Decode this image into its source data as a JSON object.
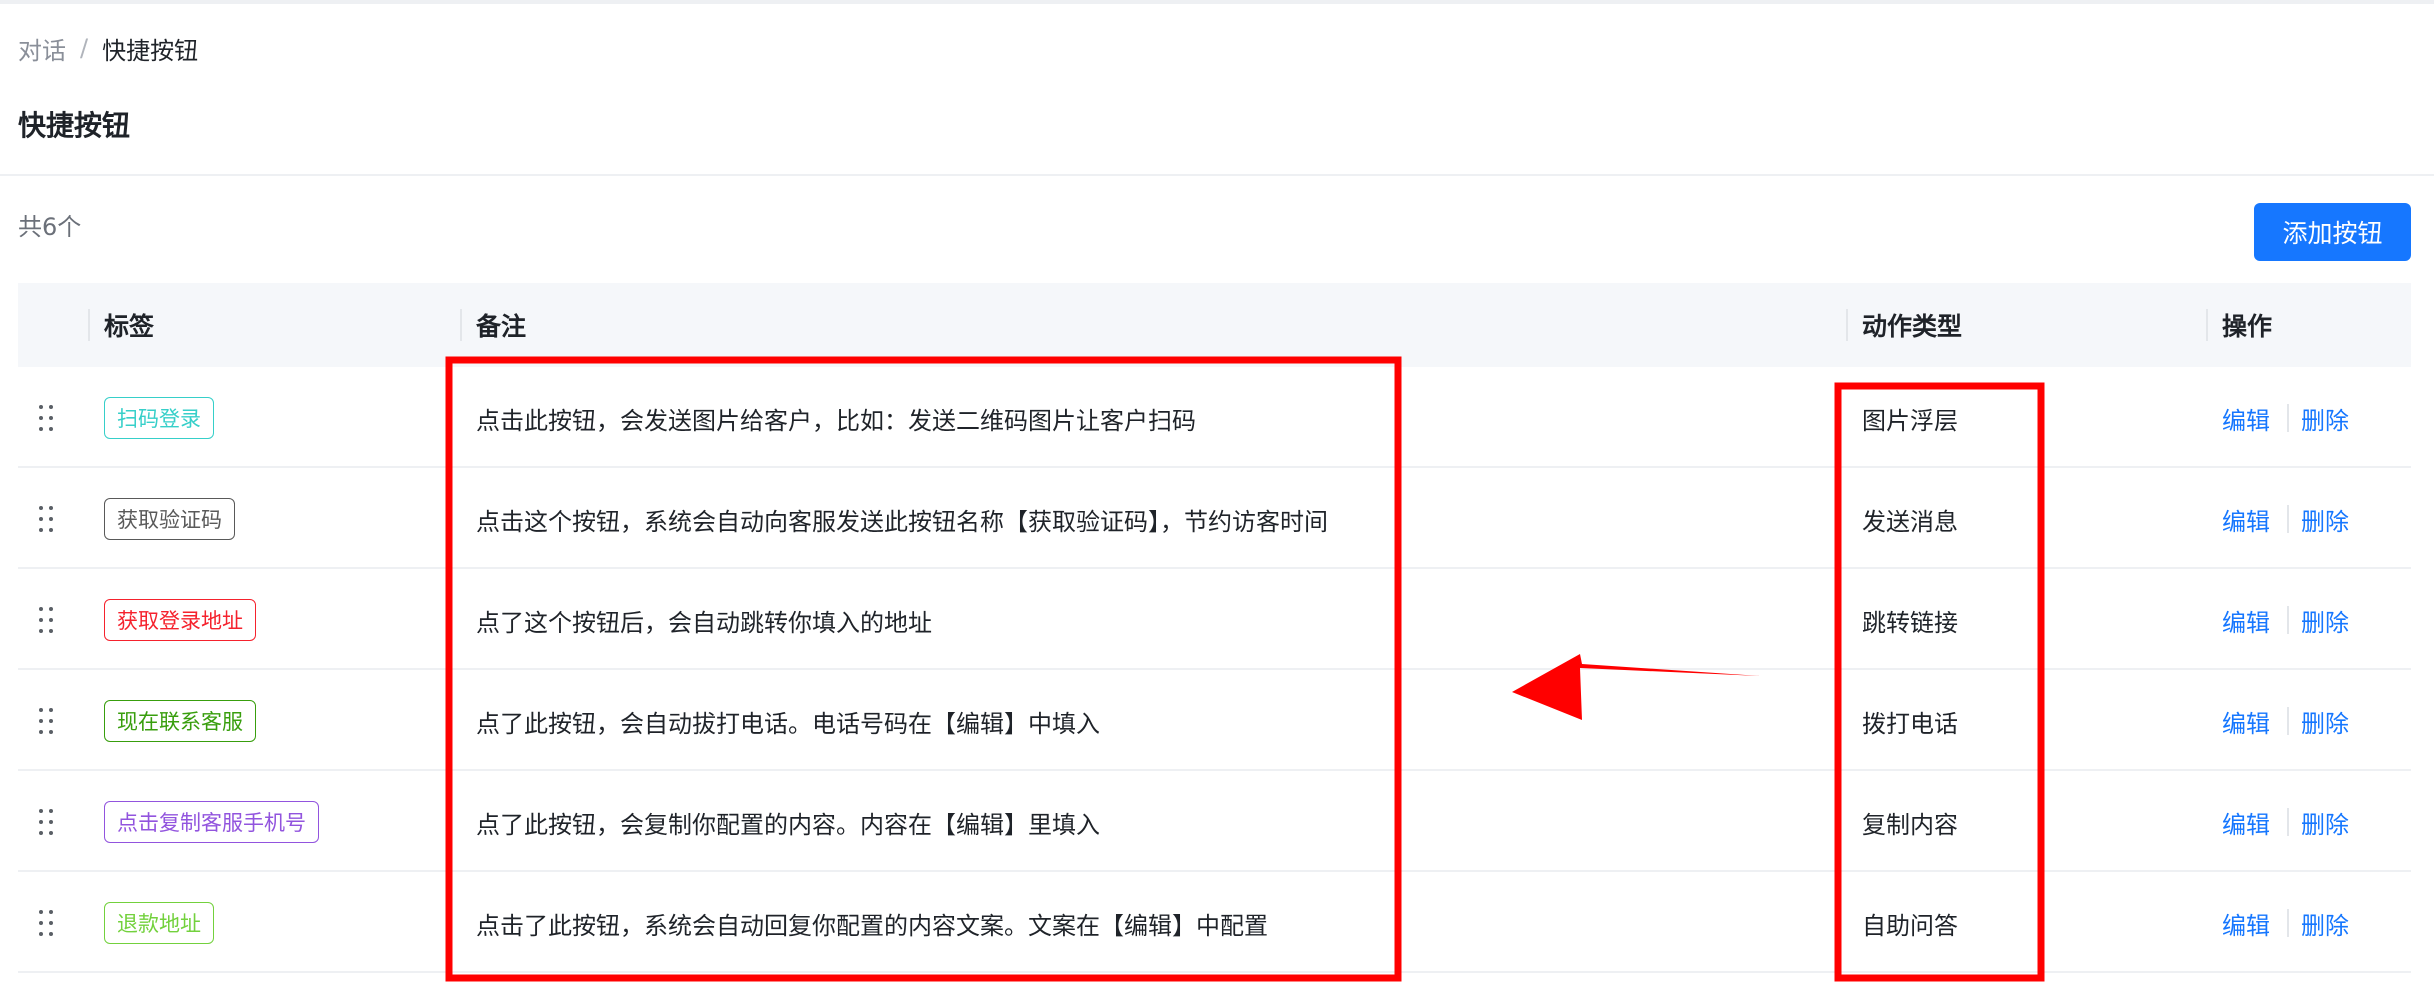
{
  "breadcrumb": {
    "parent": "对话",
    "separator": "/",
    "current": "快捷按钮"
  },
  "page_title": "快捷按钮",
  "count_text": "共6个",
  "add_button_label": "添加按钮",
  "table": {
    "headers": {
      "label": "标签",
      "note": "备注",
      "action_type": "动作类型",
      "operation": "操作"
    },
    "edit_label": "编辑",
    "delete_label": "删除",
    "rows": [
      {
        "tag": "扫码登录",
        "tag_color": "#36cfc9",
        "note": "点击此按钮，会发送图片给客户，比如：发送二维码图片让客户扫码",
        "action_type": "图片浮层"
      },
      {
        "tag": "获取验证码",
        "tag_color": "#595959",
        "note": "点击这个按钮，系统会自动向客服发送此按钮名称【获取验证码】，节约访客时间",
        "action_type": "发送消息"
      },
      {
        "tag": "获取登录地址",
        "tag_color": "#f5222d",
        "note": "点了这个按钮后，会自动跳转你填入的地址",
        "action_type": "跳转链接"
      },
      {
        "tag": "现在联系客服",
        "tag_color": "#389e0d",
        "note": "点了此按钮，会自动拔打电话。电话号码在【编辑】中填入",
        "action_type": "拨打电话"
      },
      {
        "tag": "点击复制客服手机号",
        "tag_color": "#9254de",
        "note": "点了此按钮，会复制你配置的内容。内容在【编辑】里填入",
        "action_type": "复制内容"
      },
      {
        "tag": "退款地址",
        "tag_color": "#73d13d",
        "note": "点击了此按钮，系统会自动回复你配置的内容文案。文案在【编辑】中配置",
        "action_type": "自助问答"
      }
    ]
  },
  "colors": {
    "primary": "#1677ff",
    "annotation_red": "#ff0000",
    "header_bg": "#f5f7fa"
  }
}
